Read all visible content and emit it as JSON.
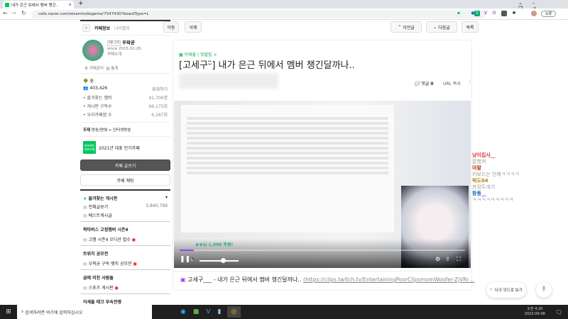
{
  "browser": {
    "tab_title": "내가 은근 뒤에서 멤버 챙긴..",
    "url": "cafe.naver.com/steamindiegame/7547430?boardType=L",
    "profile_label": "오류"
  },
  "sidebar": {
    "tab_cafe_info": "카페정보",
    "tab_my_activity": "나의활동",
    "manager_badge": "매니저",
    "manager_name": "우왁굳",
    "since": "since 2015.02.26.",
    "cafe_intro": "카페소개",
    "cafe_manage": "카페관리",
    "stats": "통계",
    "level": "숲",
    "members": "403,426",
    "invite": "초대하기",
    "stat_rows": [
      {
        "label": "즐겨찾는 멤버",
        "value": "41,706명"
      },
      {
        "label": "게시판 구독수",
        "value": "66,175회"
      },
      {
        "label": "우리카페앱 수",
        "value": "6,287회"
      }
    ],
    "topic_label": "주제",
    "topic": "방송/연예 > 인터넷방송",
    "naver_badge": "NAVER 대표카페",
    "award": "2021년 대표 인기카페",
    "write_button": "카페 글쓰기",
    "chat_button": "카페 채팅",
    "favorites": "즐겨찾는 게시판",
    "boards": [
      {
        "type": "item",
        "label": "전체글보기",
        "count": "5,840,799"
      },
      {
        "type": "item",
        "label": "베스트게시글"
      },
      {
        "type": "head",
        "label": "왁타버스 고정멤버 시즌4"
      },
      {
        "type": "item",
        "label": "고멤 시즌4 오디션 접수",
        "new": true
      },
      {
        "type": "head",
        "label": "트위치 공모전"
      },
      {
        "type": "item",
        "label": "우왁굳 구독 뱃지 공모전",
        "new": true
      },
      {
        "type": "head",
        "label": "곱에 미친 사람들"
      },
      {
        "type": "item",
        "label": "스포츠 게시판",
        "new": true
      },
      {
        "type": "head",
        "label": "이세돌 태크 부속전쟁"
      }
    ]
  },
  "toolbar": {
    "move": "이동",
    "delete": "삭제",
    "prev": "이전글",
    "next": "다음글",
    "list": "목록"
  },
  "article": {
    "breadcrumb": "이세돌 | 핫클립 >",
    "title": "[고세구ᵕ̈] 내가 은근 뒤에서 멤버 챙긴달까나..",
    "comments_label": "댓글",
    "comments_count": "0",
    "url_copy": "URL 복사",
    "video": {
      "donation": "♚♚님 1,000 후원!",
      "progress": 0.05,
      "volume": 0.6
    },
    "link_title": "고세구___ - 내가 은근 뒤에서 멤버 챙긴달까나..",
    "link_url": "(https://clips.twitch.tv/EntertainingPoorClipsmomWoofer-ZjVRr…"
  },
  "chat": [
    {
      "name": "냥이집사__",
      "msg": "잘했져",
      "color": "#d93636"
    },
    {
      "name": "야팔",
      "msg": "키보드는 언제ㅋㅋㅋㅋ",
      "color": "#c0390b"
    },
    {
      "name": "럭도04",
      "msg": "프장두개기",
      "color": "#b8860b"
    },
    {
      "name": "팡퐁__",
      "msg": "ㅋㅋㅋㅋㅋㅋㅋㅋㅋ",
      "color": "#1e62c0"
    }
  ],
  "dark_mode": "다크 모드로 보기",
  "taskbar": {
    "search": "검색하려면 여기에 입력하십시오",
    "time": "오전 4:20",
    "date": "2022-09-08"
  },
  "colors": {
    "naver_green": "#03c75a",
    "purple": "#9146ff"
  }
}
